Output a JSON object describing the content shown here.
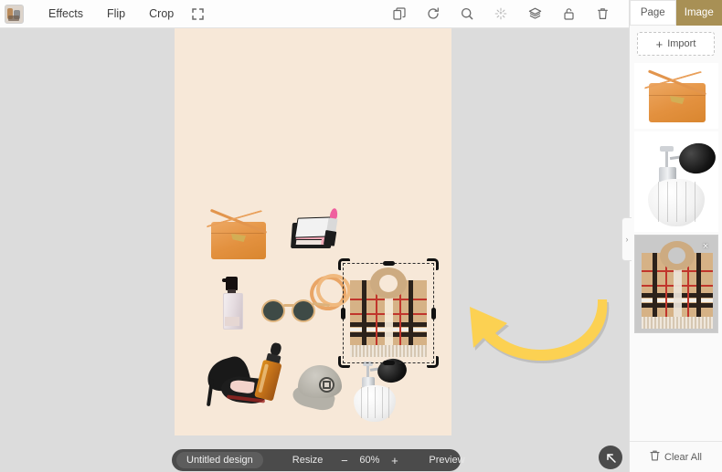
{
  "app": {
    "logo_name": "app-logo"
  },
  "toolbar": {
    "items": [
      {
        "label": "Effects",
        "name": "effects"
      },
      {
        "label": "Flip",
        "name": "flip"
      },
      {
        "label": "Crop",
        "name": "crop"
      }
    ],
    "fullscreen_icon": "fullscreen-icon",
    "right_icons": [
      {
        "name": "duplicate-icon"
      },
      {
        "name": "rotate-icon"
      },
      {
        "name": "magnifier-icon"
      },
      {
        "name": "sparkle-icon"
      },
      {
        "name": "layers-icon"
      },
      {
        "name": "lock-icon"
      },
      {
        "name": "trash-icon"
      }
    ]
  },
  "canvas": {
    "background_color": "#f7e8d8",
    "workspace_color": "#dcdcdc",
    "annotation_arrow_color": "#fcd152",
    "stickers": [
      {
        "name": "handbag-sticker"
      },
      {
        "name": "makeup-palette-sticker"
      },
      {
        "name": "lipstick-sticker"
      },
      {
        "name": "bangles-sticker"
      },
      {
        "name": "foundation-bottle-sticker"
      },
      {
        "name": "sunglasses-sticker"
      },
      {
        "name": "stiletto-heels-sticker"
      },
      {
        "name": "dropper-bottle-sticker"
      },
      {
        "name": "baseball-cap-sticker"
      },
      {
        "name": "perfume-atomizer-sticker"
      },
      {
        "name": "scarf-sticker"
      }
    ],
    "selected_sticker": "scarf-sticker"
  },
  "bottombar": {
    "design_name": "Untitled design",
    "resize_label": "Resize",
    "zoom_out_icon": "−",
    "zoom_level": "60%",
    "zoom_in_icon": "+",
    "preview_label": "Preview"
  },
  "collapse_button": {
    "name": "collapse-panel-button",
    "icon": "arrow-up-left-icon"
  },
  "panel": {
    "tabs": [
      {
        "label": "Page",
        "name": "tab-page",
        "active": false
      },
      {
        "label": "Image",
        "name": "tab-image",
        "active": true
      }
    ],
    "active_tab_color": "#a89055",
    "import_label": "Import",
    "import_icon": "plus-icon",
    "thumbnails": [
      {
        "name": "thumb-handbag",
        "selected": false
      },
      {
        "name": "thumb-perfume",
        "selected": false
      },
      {
        "name": "thumb-scarf",
        "selected": true,
        "close_icon": "×"
      }
    ],
    "collapse_chevron": "›",
    "clear_all_label": "Clear All",
    "clear_all_icon": "trash-icon"
  }
}
